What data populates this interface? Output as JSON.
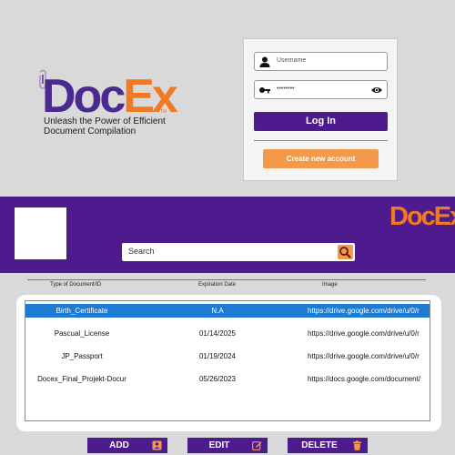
{
  "brand": {
    "logo_doc": "Doc",
    "logo_ex": "Ex",
    "logo_tm": "TM",
    "tagline_line1": "Unleash the Power of Efficient",
    "tagline_line2": "Document Compilation"
  },
  "login": {
    "username_placeholder": "Username",
    "password_value": "••••••••",
    "login_label": "Log In",
    "create_account_label": "Create new account"
  },
  "header": {
    "search_placeholder": "Search"
  },
  "table": {
    "columns": [
      "Type of Document/ID",
      "Expiration Date",
      "Image"
    ],
    "rows": [
      {
        "type": "Birth_Certificate",
        "expiry": "N.A",
        "image": "https://drive.google.com/drive/u/0/r",
        "selected": true
      },
      {
        "type": "Pascual_License",
        "expiry": "01/14/2025",
        "image": "https://drive.google.com/drive/u/0/r",
        "selected": false
      },
      {
        "type": "JP_Passport",
        "expiry": "01/19/2024",
        "image": "https://drive.google.com/drive/u/0/r",
        "selected": false
      },
      {
        "type": "Docex_Final_Projekt-Docur",
        "expiry": "05/26/2023",
        "image": "https://docs.google.com/document/",
        "selected": false
      }
    ]
  },
  "actions": {
    "add_label": "ADD",
    "edit_label": "EDIT",
    "delete_label": "DELETE"
  },
  "colors": {
    "purple": "#4d1b8e",
    "orange": "#f2994a",
    "selection": "#1e7bd2"
  },
  "icons": {
    "user": "user-icon",
    "key": "key-icon",
    "eye": "eye-icon",
    "search": "search-icon",
    "clip": "paperclip-icon",
    "add": "contact-card-icon",
    "edit": "edit-icon",
    "delete": "trash-icon"
  }
}
